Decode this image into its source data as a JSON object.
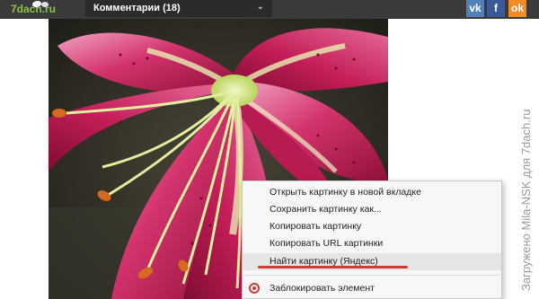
{
  "header": {
    "logo_text": "7dach.ru",
    "comments_label": "Комментарии (18)",
    "social": {
      "vk": "vk",
      "fb": "f",
      "ok": "ok"
    }
  },
  "watermark": "Загружено Mila-NSK для 7dach.ru",
  "context_menu": {
    "items": [
      "Открыть картинку в новой вкладке",
      "Сохранить картинку как...",
      "Копировать картинку",
      "Копировать URL картинки",
      "Найти картинку (Яндекс)",
      "Заблокировать элемент"
    ],
    "highlighted_index": 4
  },
  "colors": {
    "topbar": "#3a3a3a",
    "petal": "#c2185b",
    "underline": "#d23a3a"
  }
}
